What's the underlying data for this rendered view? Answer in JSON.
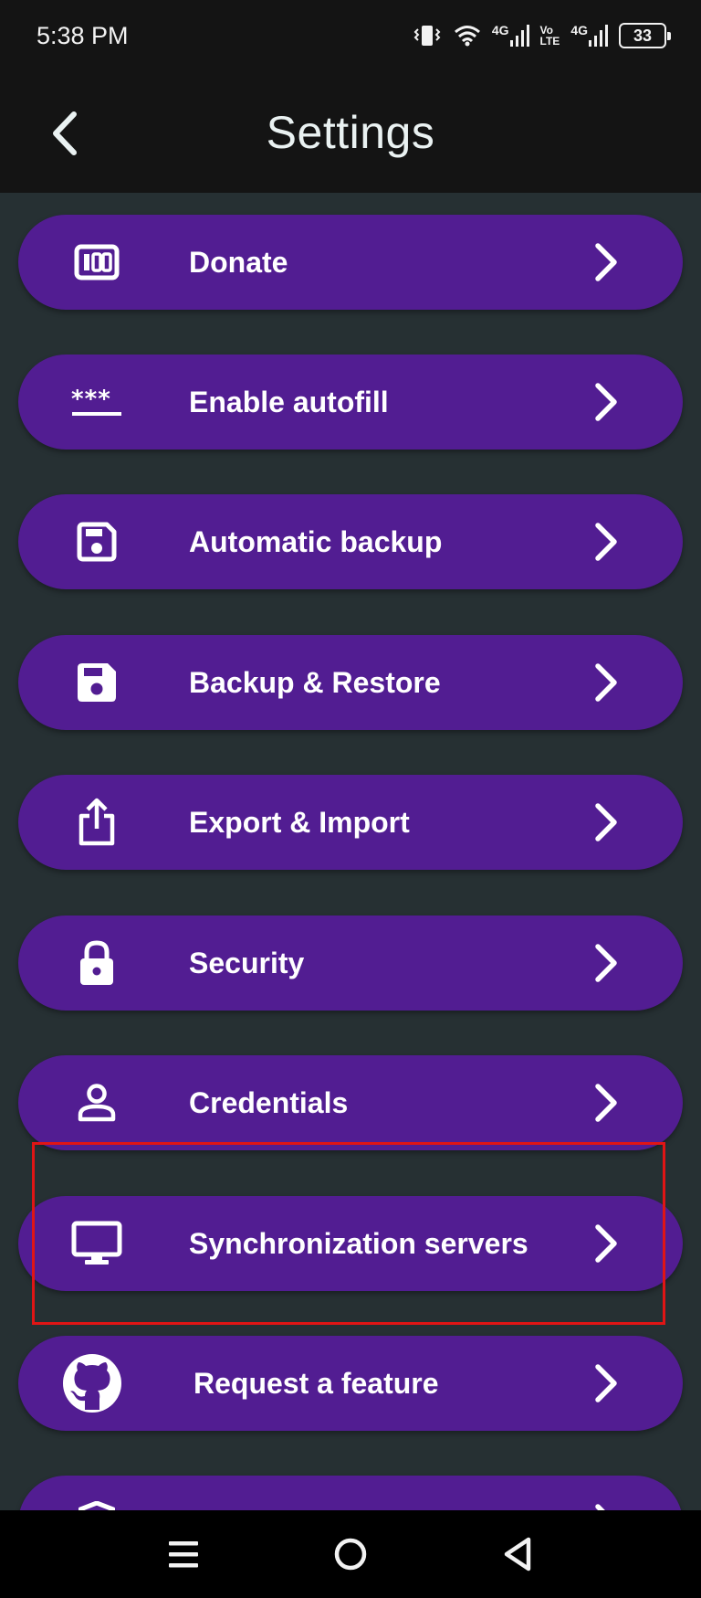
{
  "status": {
    "time": "5:38 PM",
    "net1": "4G",
    "volte_top": "Vo",
    "volte_bottom": "LTE",
    "net2": "4G",
    "battery": "33"
  },
  "header": {
    "title": "Settings"
  },
  "settings": {
    "items": [
      {
        "label": "Donate",
        "icon": "donate-icon"
      },
      {
        "label": "Enable autofill",
        "icon": "password-icon"
      },
      {
        "label": "Automatic backup",
        "icon": "save-outline-icon"
      },
      {
        "label": "Backup & Restore",
        "icon": "save-icon"
      },
      {
        "label": "Export & Import",
        "icon": "share-icon"
      },
      {
        "label": "Security",
        "icon": "lock-icon"
      },
      {
        "label": "Credentials",
        "icon": "person-icon"
      },
      {
        "label": "Synchronization servers",
        "icon": "monitor-icon"
      },
      {
        "label": "Request a feature",
        "icon": "github-icon"
      },
      {
        "label": "",
        "icon": "shield-icon"
      }
    ]
  },
  "colors": {
    "background": "#263033",
    "bar": "#141414",
    "item": "#521d92",
    "highlight": "#e01515"
  },
  "nav": {
    "icons": [
      "menu-icon",
      "home-circle-icon",
      "back-triangle-icon"
    ]
  }
}
